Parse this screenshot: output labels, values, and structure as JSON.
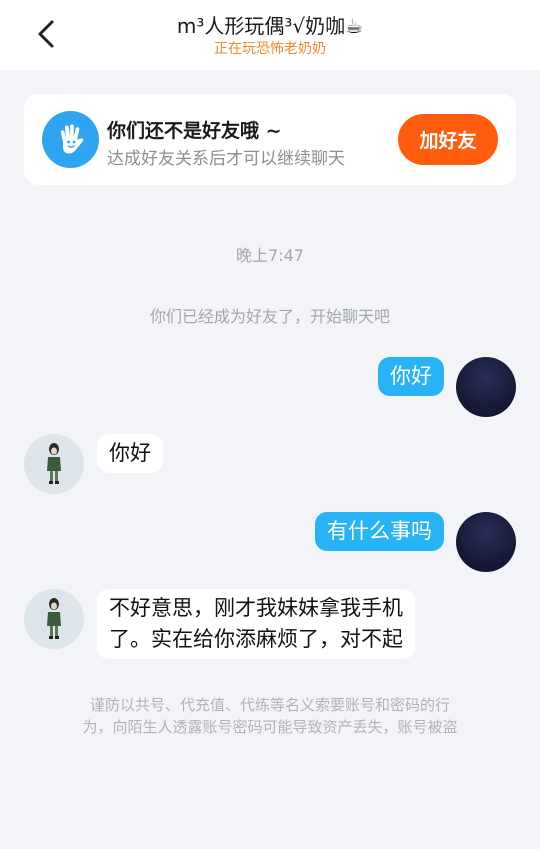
{
  "header": {
    "title": "m³人形玩偶³√奶咖☕",
    "status": "正在玩恐怖老奶奶"
  },
  "friend_card": {
    "title": "你们还不是好友哦 ~",
    "description": "达成好友关系后才可以继续聊天",
    "button_label": "加好友",
    "icon": "hand-wave-icon"
  },
  "chat": {
    "timestamp": "晚上7:47",
    "system_message": "你们已经成为好友了，开始聊天吧",
    "messages": [
      {
        "sender": "me",
        "text": "你好"
      },
      {
        "sender": "other",
        "text": "你好"
      },
      {
        "sender": "me",
        "text": "有什么事吗"
      },
      {
        "sender": "other",
        "lines": [
          "不好意思，刚才我妹妹拿我手机",
          "了。实在给你添麻烦了，对不起"
        ]
      }
    ]
  },
  "notice": {
    "lines": [
      "谨防以共号、代充值、代练等名义索要账号和密码的行",
      "为，向陌生人透露账号密码可能导致资产丢失，账号被盗"
    ]
  },
  "colors": {
    "accent_orange": "#ff5c0d",
    "bubble_blue": "#27b3f5",
    "status_orange": "#f08a30",
    "background": "#f3f4f8"
  }
}
